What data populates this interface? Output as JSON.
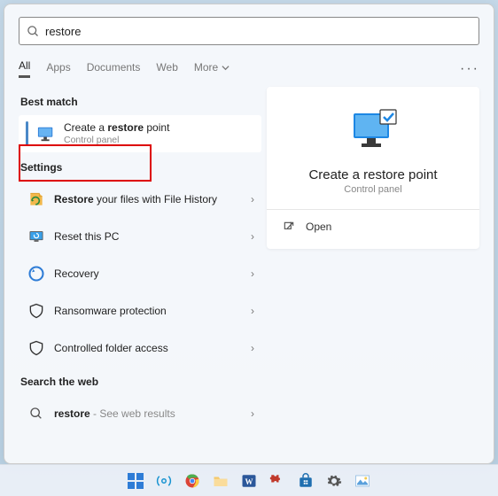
{
  "search": {
    "value": "restore"
  },
  "tabs": {
    "items": [
      "All",
      "Apps",
      "Documents",
      "Web",
      "More"
    ],
    "active": 0,
    "more_has_chevron": true
  },
  "sections": {
    "best_match": "Best match",
    "settings": "Settings",
    "search_web": "Search the web"
  },
  "best": {
    "title_pre": "Create a ",
    "title_bold": "restore",
    "title_post": " point",
    "subtitle": "Control panel"
  },
  "settings_items": [
    {
      "icon": "history-icon",
      "pre": "",
      "bold": "Restore",
      "post": " your files with File History"
    },
    {
      "icon": "reset-icon",
      "pre": "Reset this PC",
      "bold": "",
      "post": ""
    },
    {
      "icon": "recovery-icon",
      "pre": "Recovery",
      "bold": "",
      "post": ""
    },
    {
      "icon": "ransomware-icon",
      "pre": "Ransomware protection",
      "bold": "",
      "post": ""
    },
    {
      "icon": "folder-access-icon",
      "pre": "Controlled folder access",
      "bold": "",
      "post": ""
    }
  ],
  "web_item": {
    "term": "restore",
    "suffix": " - See web results"
  },
  "preview": {
    "title": "Create a restore point",
    "subtitle": "Control panel",
    "action": "Open"
  },
  "colors": {
    "accent": "#4a88c7",
    "callout": "#d00"
  }
}
